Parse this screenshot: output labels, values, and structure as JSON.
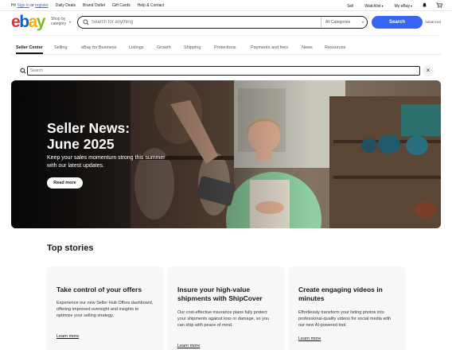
{
  "topbar": {
    "greeting": "Hi!",
    "sign_in": "Sign in",
    "or": "or",
    "register": "register",
    "links": [
      "Daily Deals",
      "Brand Outlet",
      "Gift Cards",
      "Help & Contact"
    ],
    "sell": "Sell",
    "watchlist": "Watchlist",
    "my_ebay": "My eBay"
  },
  "header": {
    "logo": {
      "e": "e",
      "b": "b",
      "a": "a",
      "y": "y"
    },
    "shop_by": "Shop by",
    "category": "category",
    "search_placeholder": "Search for anything",
    "category_select": "All Categories",
    "search_button": "Search",
    "advanced": "Advanced"
  },
  "nav": {
    "items": [
      "Seller Center",
      "Selling",
      "eBay for Business",
      "Listings",
      "Growth",
      "Shipping",
      "Protections",
      "Payments and fees",
      "News",
      "Resources"
    ],
    "active_index": 0
  },
  "seller_search": {
    "placeholder": "Search"
  },
  "hero": {
    "title": "Seller News: June 2025",
    "subtitle": "Keep your sales momentum strong this summer with our latest updates.",
    "cta": "Read more"
  },
  "top_stories": {
    "heading": "Top stories",
    "cards": [
      {
        "title": "Take control of your offers",
        "body": "Experience our new Seller Hub Offers dashboard, offering improved oversight and insights to optimize your selling strategy.",
        "link": "Learn more"
      },
      {
        "title": "Insure your high-value shipments with ShipCover",
        "body": "Our cost-effective insurance plans fully protect your shipments against loss or damage, so you can ship with peace of mind.",
        "link": "Learn more"
      },
      {
        "title": "Create engaging videos in minutes",
        "body": "Effortlessly transform your listing photos into professional-quality videos for social media with our new AI-powered tool.",
        "link": "Learn more"
      }
    ]
  },
  "colors": {
    "brand_blue": "#3665f3",
    "logo_red": "#e53238",
    "logo_blue": "#0064d2",
    "logo_yellow": "#f5af02",
    "logo_green": "#86b817"
  }
}
